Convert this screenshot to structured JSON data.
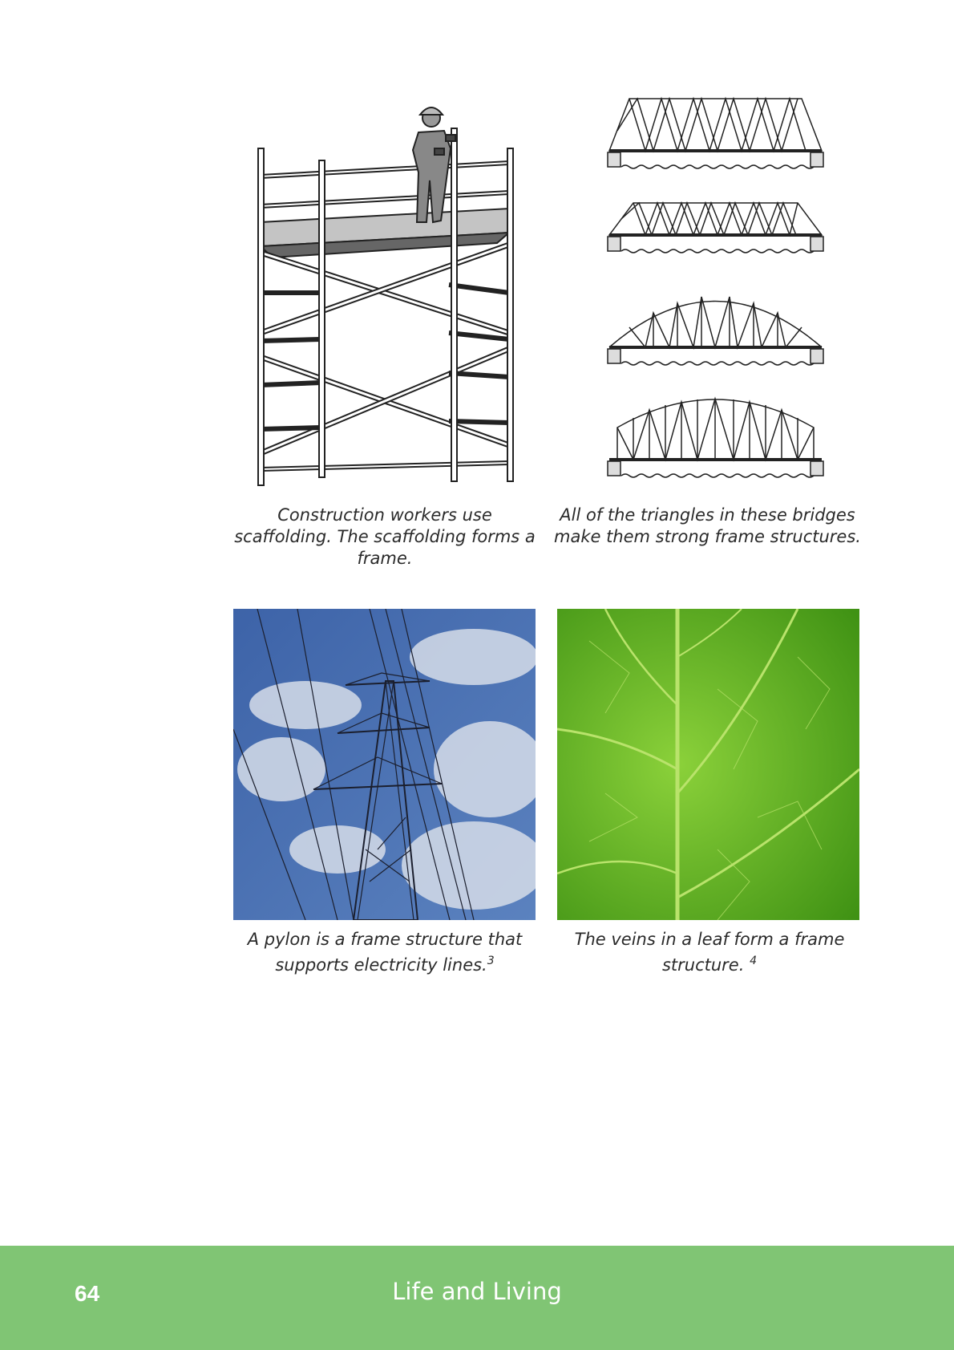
{
  "figures": {
    "scaffolding": {
      "icon": "scaffolding-illustration",
      "caption_line1": "Construction workers use",
      "caption_line2": "scaffolding.  The scaffolding forms a",
      "caption_line3": "frame."
    },
    "bridges": {
      "icon": "truss-bridges-illustration",
      "caption_line1": "All of the triangles in these bridges",
      "caption_line2": "make them strong frame structures."
    },
    "pylon": {
      "icon": "electricity-pylon-photo",
      "caption_line1": "A pylon is a frame structure that",
      "caption_line2": "supports electricity lines.",
      "footnote": "3"
    },
    "leaf": {
      "icon": "leaf-veins-photo",
      "caption_line1": "The veins in a leaf form a frame",
      "caption_line2": "structure. ",
      "footnote": "4"
    }
  },
  "footer": {
    "page_number": "64",
    "title": "Life and Living",
    "color": "#80c574"
  }
}
